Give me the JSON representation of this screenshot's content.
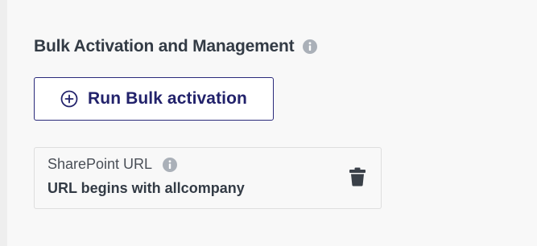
{
  "section": {
    "title": "Bulk Activation and Management",
    "info_icon": "info-icon"
  },
  "run_button": {
    "label": "Run Bulk activation",
    "icon": "plus-circle-icon"
  },
  "filter_card": {
    "label": "SharePoint URL",
    "info_icon": "info-icon",
    "value": "URL begins with allcompany",
    "delete_icon": "trash-icon"
  },
  "colors": {
    "background": "#f8f8f8",
    "title_text": "#333b45",
    "button_border": "#2a2a7a",
    "button_text": "#22226b",
    "info_icon": "#aab0b8",
    "trash_icon": "#3a4048"
  }
}
